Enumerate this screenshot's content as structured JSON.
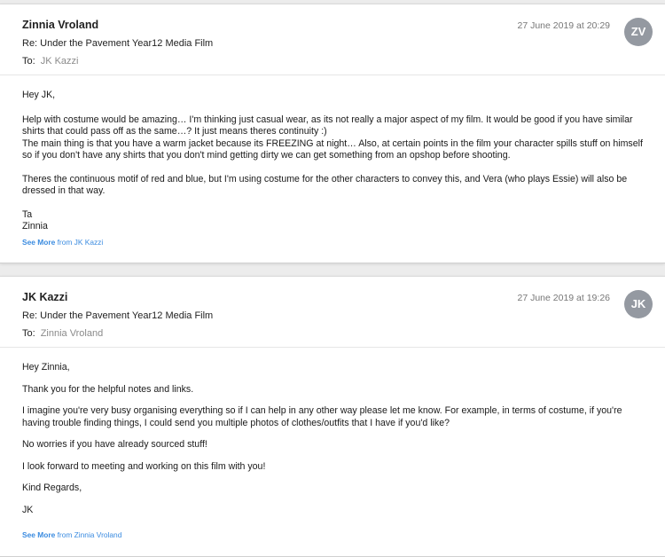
{
  "emails": [
    {
      "sender": "Zinnia Vroland",
      "date": "27 June 2019 at 20:29",
      "avatar_initials": "ZV",
      "subject": "Re: Under the Pavement Year12 Media Film",
      "to_label": "To:",
      "to_name": "JK Kazzi",
      "body": [
        "Hey JK,",
        "Help with costume would be amazing… I'm thinking just casual wear, as its not really a major aspect of my film. It would be good if you have similar shirts that could pass off as the same…? It just means theres continuity :)",
        "The main thing is that you have a warm jacket because its FREEZING at night… Also, at certain points in the film your character spills stuff on himself so if you don't have any shirts that you don't mind getting dirty we can get something from an opshop before shooting.",
        "Theres the continuous motif of red and blue, but I'm using costume for the other characters to convey this, and Vera (who plays Essie) will also be dressed in that way.",
        "Ta",
        "Zinnia"
      ],
      "see_more_label": "See More",
      "see_more_from": "from JK Kazzi"
    },
    {
      "sender": "JK Kazzi",
      "date": "27 June 2019 at 19:26",
      "avatar_initials": "JK",
      "subject": "Re: Under the Pavement Year12 Media Film",
      "to_label": "To:",
      "to_name": "Zinnia Vroland",
      "body": [
        "Hey Zinnia,",
        "Thank you for the helpful notes and links.",
        "I imagine you're very busy organising everything so if I can help in any other way please let me know. For example, in terms of costume, if you're having trouble finding things, I could send you multiple photos of clothes/outfits that I have if you'd like?",
        "No worries if you have already sourced stuff!",
        "I look forward to meeting and working on this film with you!",
        "Kind Regards,",
        "JK"
      ],
      "see_more_label": "See More",
      "see_more_from": "from Zinnia Vroland"
    }
  ],
  "colors": {
    "link": "#3a8be0",
    "avatar_bg": "#9499a1",
    "muted_text": "#8a8a8a"
  }
}
